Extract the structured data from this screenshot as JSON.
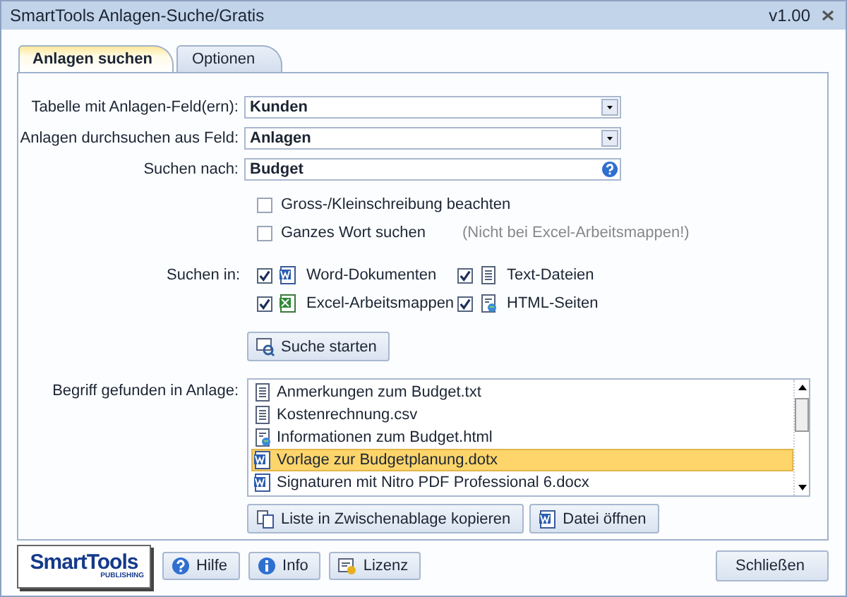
{
  "window": {
    "title": "SmartTools Anlagen-Suche/Gratis",
    "version": "v1.00"
  },
  "tabs": [
    {
      "label": "Anlagen suchen",
      "selected": true
    },
    {
      "label": "Optionen",
      "selected": false
    }
  ],
  "form": {
    "fields": [
      {
        "label": "Tabelle mit Anlagen-Feld(ern):",
        "kind": "dropdown",
        "value": "Kunden"
      },
      {
        "label": "Anlagen durchsuchen aus Feld:",
        "kind": "dropdown",
        "value": "Anlagen"
      },
      {
        "label": "Suchen nach:",
        "kind": "text",
        "value": "Budget"
      }
    ],
    "options": [
      {
        "label": "Gross-/Kleinschreibung beachten",
        "checked": false
      },
      {
        "label": "Ganzes Wort suchen",
        "checked": false,
        "note": "(Nicht bei Excel-Arbeitsmappen!)"
      }
    ],
    "search_in_label": "Suchen in:",
    "search_in": [
      {
        "label": "Word-Dokumenten",
        "checked": true,
        "kind": "word"
      },
      {
        "label": "Text-Dateien",
        "checked": true,
        "kind": "text"
      },
      {
        "label": "Excel-Arbeitsmappen",
        "checked": true,
        "kind": "excel"
      },
      {
        "label": "HTML-Seiten",
        "checked": true,
        "kind": "html"
      }
    ],
    "search_button": "Suche starten"
  },
  "results": {
    "label": "Begriff gefunden in Anlage:",
    "items": [
      {
        "name": "Anmerkungen zum Budget.txt",
        "kind": "text",
        "selected": false
      },
      {
        "name": "Kostenrechnung.csv",
        "kind": "text",
        "selected": false
      },
      {
        "name": "Informationen zum Budget.html",
        "kind": "html",
        "selected": false
      },
      {
        "name": "Vorlage zur Budgetplanung.dotx",
        "kind": "word",
        "selected": true
      },
      {
        "name": "Signaturen mit Nitro PDF Professional 6.docx",
        "kind": "word",
        "selected": false
      }
    ],
    "buttons": [
      {
        "label": "Liste in Zwischenablage kopieren",
        "kind": "copy"
      },
      {
        "label": "Datei öffnen",
        "kind": "word"
      }
    ]
  },
  "footer": {
    "logo": {
      "name": "SmartTools",
      "sub": "PUBLISHING"
    },
    "buttons": [
      {
        "label": "Hilfe",
        "kind": "help"
      },
      {
        "label": "Info",
        "kind": "info"
      },
      {
        "label": "Lizenz",
        "kind": "license"
      }
    ],
    "close_button": "Schließen"
  }
}
